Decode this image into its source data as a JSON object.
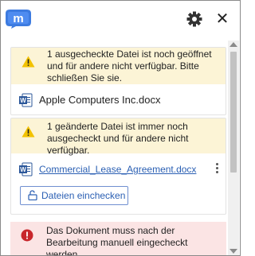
{
  "header": {
    "logo_icon": "m-logo-icon",
    "settings_icon": "gear-icon",
    "close_icon": "close-icon",
    "close_glyph": "✕"
  },
  "card1": {
    "warning": "1 ausgecheckte Datei ist noch geöffnet und für andere nicht verfügbar. Bitte schließen Sie sie.",
    "file_name": "Apple Computers Inc.docx"
  },
  "card2": {
    "warning": "1 geänderte Datei ist immer noch ausgecheckt und für andere nicht verfügbar.",
    "file_name": "Commercial_Lease_Agreement.docx",
    "checkin_button": "Dateien einchecken"
  },
  "error": {
    "message": "Das Dokument muss nach der Bearbeitung manuell eingecheckt werden."
  },
  "colors": {
    "accent": "#2a5fb3",
    "warning_bg": "#fcf4d6",
    "error_bg": "#fbe4e4",
    "warning_icon": "#f2c200",
    "error_icon": "#c8262b",
    "word_icon": "#2b579a"
  }
}
